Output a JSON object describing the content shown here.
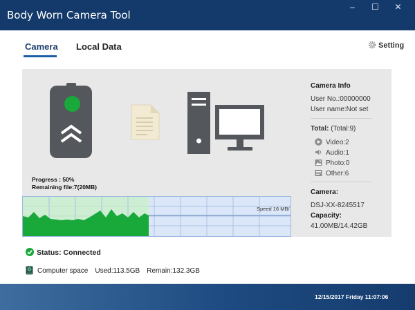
{
  "window": {
    "title": "Body Worn Camera Tool",
    "controls": {
      "minimize": "–",
      "maximize": "☐",
      "close": "✕"
    },
    "colors": {
      "titlebar": "#143a6b",
      "accent": "#1f5fa8",
      "status_ok": "#19a83a"
    }
  },
  "tabs": [
    {
      "label": "Camera",
      "active": true
    },
    {
      "label": "Local Data",
      "active": false
    }
  ],
  "setting_label": "Setting",
  "transfer": {
    "progress": "Progress : 50%",
    "remaining": "Remaining file:7(20MB)",
    "speed": "Speed 16 MB/",
    "progress_fraction": 0.5
  },
  "camera_info": {
    "header": "Camera Info",
    "user_no": "User No.:00000000",
    "user_name": "User name:Not set",
    "total_label": "Total:",
    "total_value": "(Total:9)",
    "files": [
      {
        "label": "Video:2",
        "icon": "video-icon"
      },
      {
        "label": "Audio:1",
        "icon": "audio-icon"
      },
      {
        "label": "Photo:0",
        "icon": "photo-icon"
      },
      {
        "label": "Other:6",
        "icon": "other-file-icon"
      }
    ],
    "camera_label": "Camera:",
    "camera_id": "DSJ-XX-8245517",
    "capacity_label": "Capacity:",
    "capacity_value": "41.00MB/14.42GB"
  },
  "status": {
    "text": "Status: Connected"
  },
  "computer_space": {
    "label": "Computer space",
    "used": "Used:113.5GB",
    "remain": "Remain:132.3GB"
  },
  "footer": {
    "datetime": "12/15/2017 Friday 11:07:06"
  }
}
